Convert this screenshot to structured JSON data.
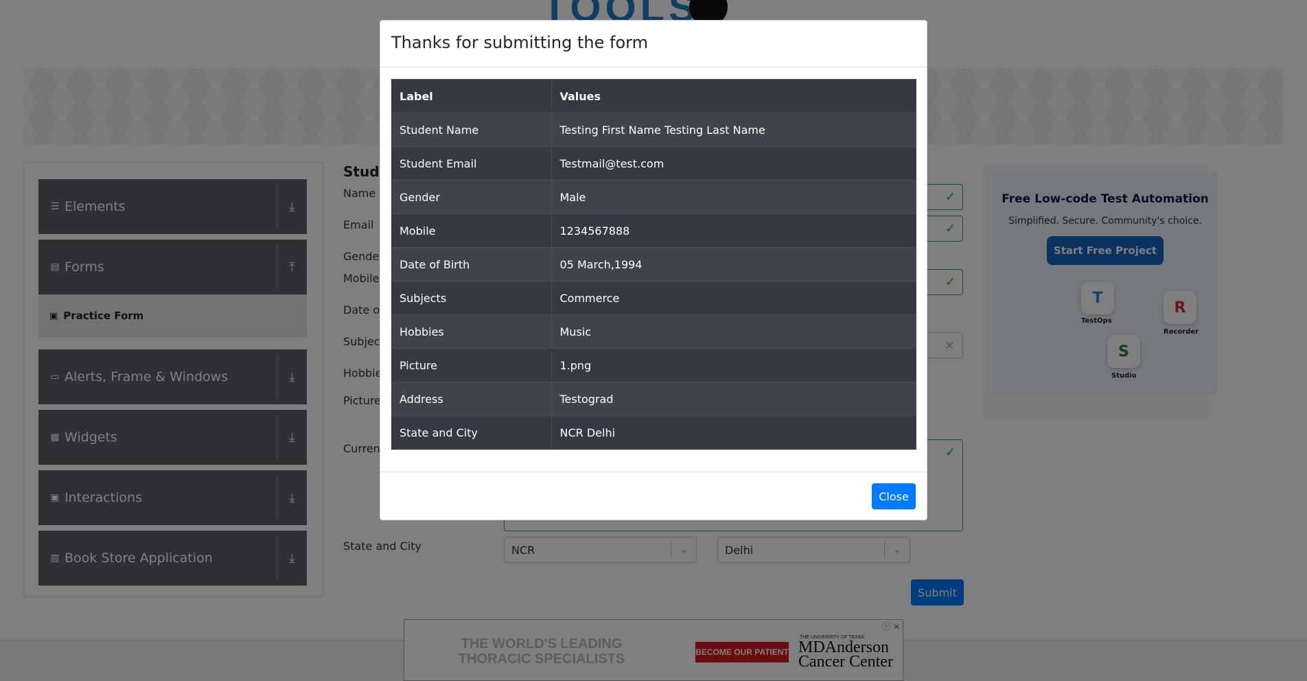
{
  "background": {
    "logo_text": "TOOLS",
    "sidebar": {
      "groups": [
        {
          "label": "Elements",
          "icon": "list-icon"
        },
        {
          "label": "Forms",
          "icon": "document-icon"
        },
        {
          "label": "Alerts, Frame & Windows",
          "icon": "window-icon"
        },
        {
          "label": "Widgets",
          "icon": "grid-icon"
        },
        {
          "label": "Interactions",
          "icon": "interaction-icon"
        },
        {
          "label": "Book Store Application",
          "icon": "books-icon"
        }
      ],
      "active_item": "Practice Form"
    },
    "form": {
      "title": "Stude",
      "labels": {
        "name": "Name",
        "email": "Email",
        "gender": "Gender",
        "mobile": "Mobile",
        "dob": "Date of",
        "subjects": "Subject",
        "hobbies": "Hobbie",
        "picture": "Picture",
        "address": "Current",
        "state_city": "State and City"
      },
      "state_value": "NCR",
      "city_value": "Delhi",
      "submit_label": "Submit"
    },
    "ad": {
      "title": "Free Low-code Test Automation",
      "subtitle": "Simplified. Secure. Community's choice.",
      "button": "Start Free Project",
      "chip_testops": "TestOps",
      "chip_recorder": "Recorder",
      "chip_studio": "Studio"
    },
    "bottom_ad": {
      "headline": "THE WORLD'S LEADING THORACIC SPECIALISTS",
      "button": "BECOME OUR PATIENT",
      "small": "THE UNIVERSITY OF TEXAS",
      "brand_line1": "MDAnderson",
      "brand_line2": "Cancer Center"
    }
  },
  "modal": {
    "title": "Thanks for submitting the form",
    "table": {
      "headers": [
        "Label",
        "Values"
      ],
      "rows": [
        [
          "Student Name",
          "Testing First Name Testing Last Name"
        ],
        [
          "Student Email",
          "Testmail@test.com"
        ],
        [
          "Gender",
          "Male"
        ],
        [
          "Mobile",
          "1234567888"
        ],
        [
          "Date of Birth",
          "05 March,1994"
        ],
        [
          "Subjects",
          "Commerce"
        ],
        [
          "Hobbies",
          "Music"
        ],
        [
          "Picture",
          "1.png"
        ],
        [
          "Address",
          "Testograd"
        ],
        [
          "State and City",
          "NCR Delhi"
        ]
      ]
    },
    "close_label": "Close"
  },
  "colors": {
    "primary": "#007bff",
    "table_dark": "#343a40",
    "valid_green": "#28a745",
    "sidebar_group": "#5c6167"
  }
}
